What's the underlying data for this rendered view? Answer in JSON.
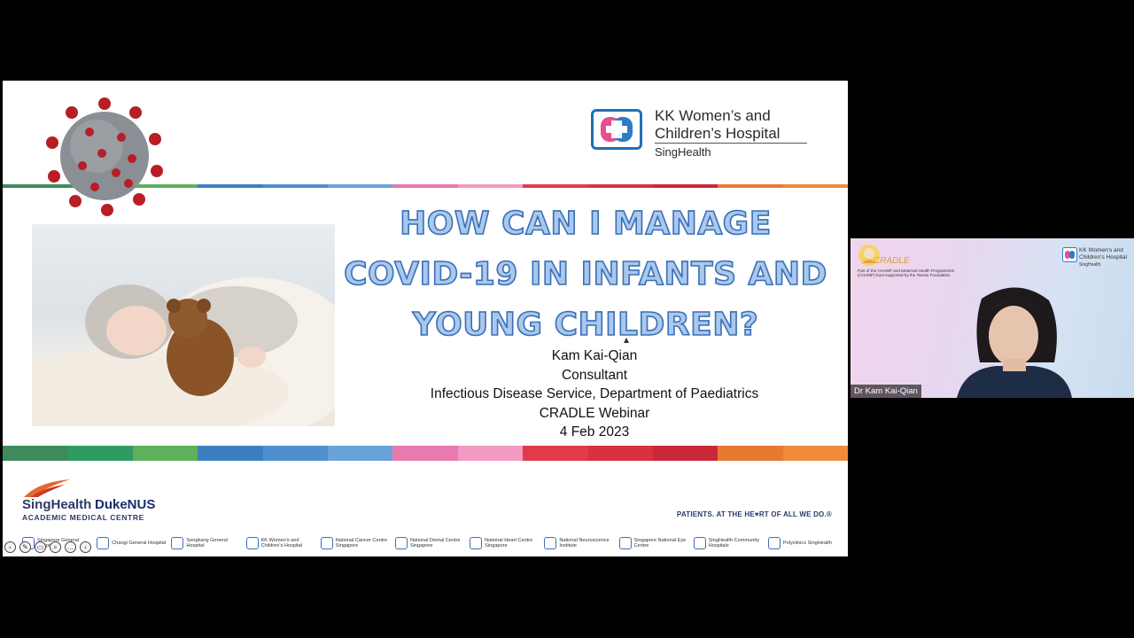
{
  "slide": {
    "title_lines": [
      "HOW CAN I MANAGE",
      "COVID-19 IN INFANTS AND",
      "YOUNG CHILDREN?"
    ],
    "presenter": "Kam Kai-Qian",
    "role": "Consultant",
    "department": "Infectious Disease Service, Department of Paediatrics",
    "event": "CRADLE Webinar",
    "date": "4 Feb 2023",
    "logo": {
      "line1": "KK Women’s and",
      "line2": "Children’s Hospital",
      "line3": "SingHealth"
    },
    "footer": {
      "singhealth": "SingHealth",
      "dukenus": "DukeNUS",
      "amc": "ACADEMIC MEDICAL CENTRE",
      "tagline": "PATIENTS. AT THE HE♥RT OF ALL WE DO.®",
      "institutions": [
        "Singapore General Hospital",
        "Changi General Hospital",
        "Sengkang General Hospital",
        "KK Women's and Children's Hospital",
        "National Cancer Centre Singapore",
        "National Dental Centre Singapore",
        "National Heart Centre Singapore",
        "National Neuroscience Institute",
        "Singapore National Eye Centre",
        "SingHealth Community Hospitals",
        "Polyclinics SingHealth"
      ]
    },
    "stripe_colors_top": [
      "#3e8a5c",
      "#2f9a62",
      "#5eb05a",
      "#3b7fc0",
      "#4e8fd0",
      "#6aa2dc",
      "#e87ab0",
      "#f29ac2",
      "#e23a4a",
      "#d8323e",
      "#c8283a",
      "#e87a30",
      "#f08a3a"
    ],
    "stripe_colors_bottom": [
      "#3e8a5c",
      "#2f9a62",
      "#5eb05a",
      "#3b7fc0",
      "#4e8fd0",
      "#6aa2dc",
      "#e87ab0",
      "#f29ac2",
      "#e23a4a",
      "#d8323e",
      "#c8283a",
      "#e87a30",
      "#f08a3a"
    ]
  },
  "video": {
    "participant_name": "Dr Kam Kai-Qian",
    "cradle_word": "CRADLE",
    "cradle_caption": "Part of the CHAMP and Maternal Health Programmes (CHAMP) fund supported by the Tanoto Foundation",
    "kk_line1": "KK Women's and",
    "kk_line2": "Children's Hospital",
    "kk_line3": "SingHealth"
  },
  "icons": {
    "virus": "virus-icon",
    "kk": "kk-hospital-logo-icon"
  }
}
